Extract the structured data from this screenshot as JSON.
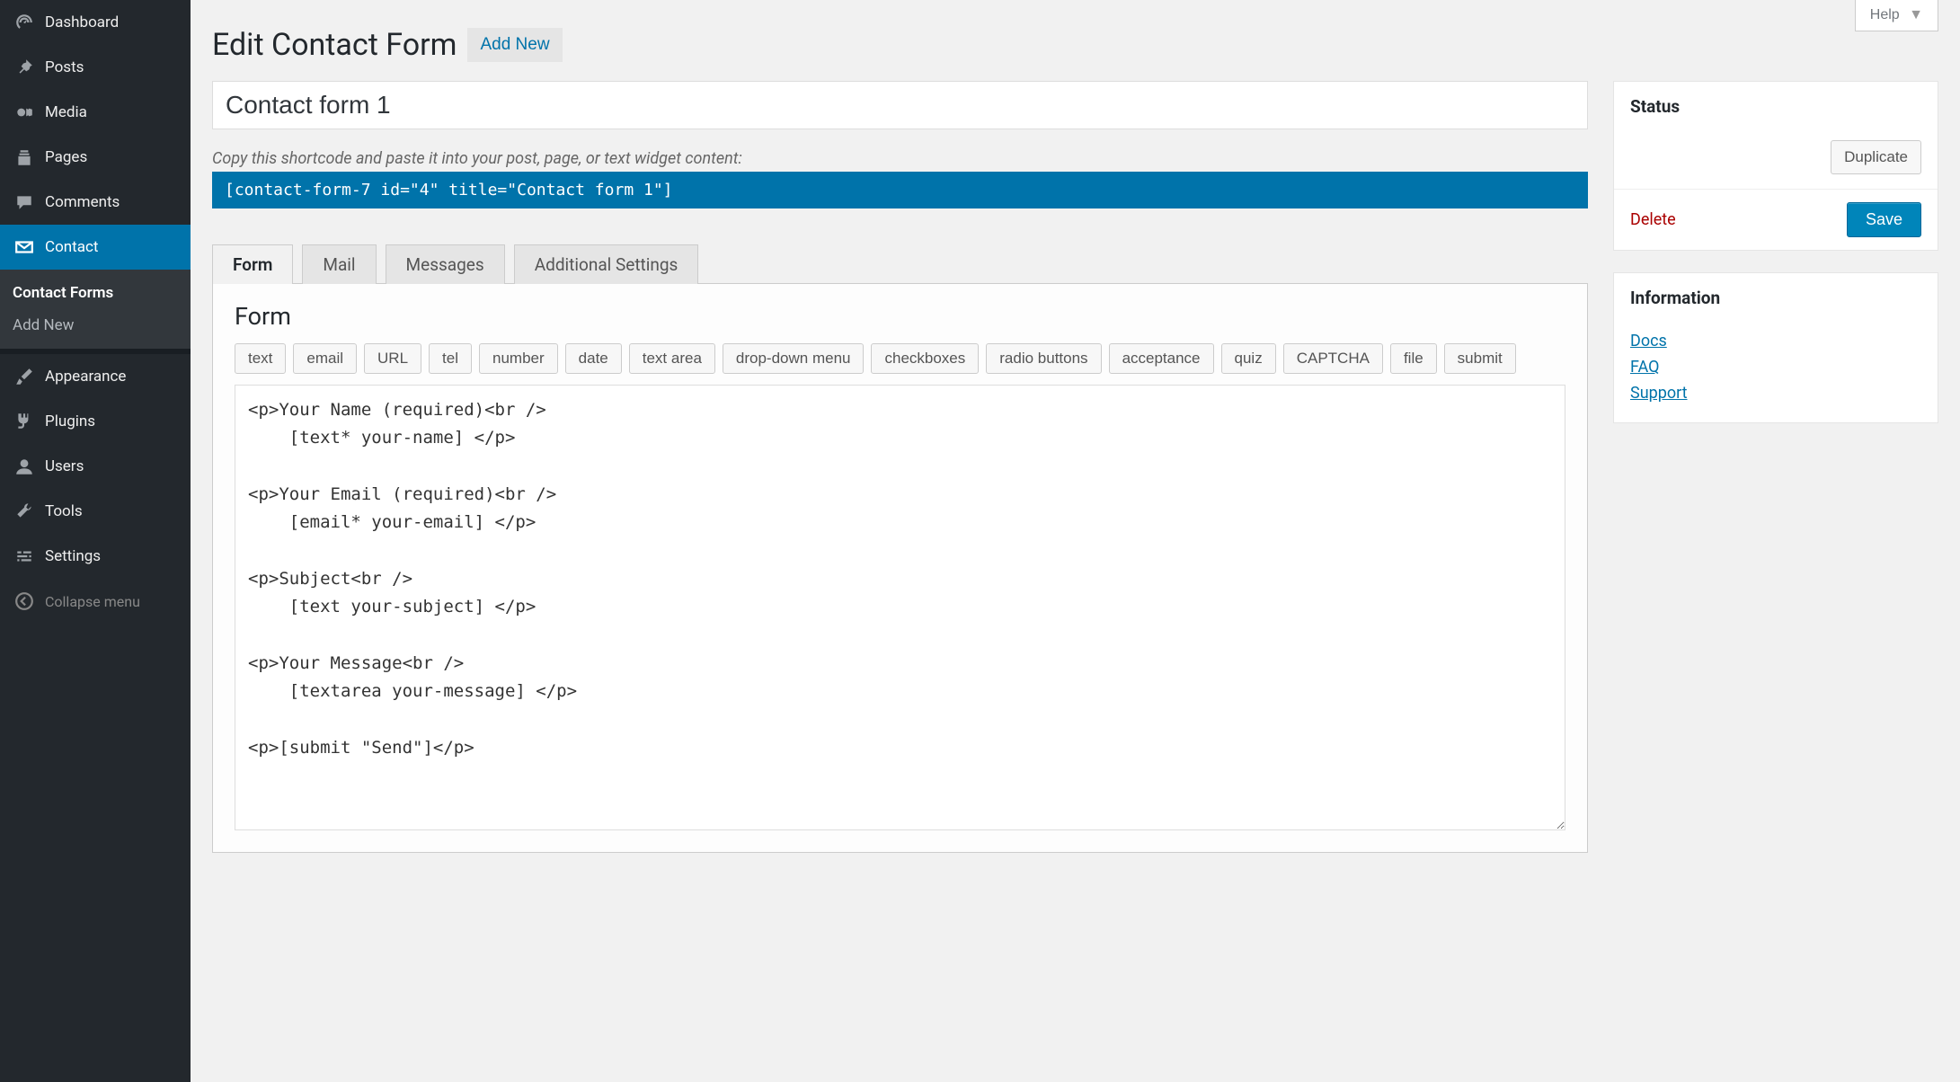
{
  "help_label": "Help",
  "sidebar": {
    "items": [
      {
        "id": "dashboard",
        "label": "Dashboard"
      },
      {
        "id": "posts",
        "label": "Posts"
      },
      {
        "id": "media",
        "label": "Media"
      },
      {
        "id": "pages",
        "label": "Pages"
      },
      {
        "id": "comments",
        "label": "Comments"
      },
      {
        "id": "contact",
        "label": "Contact"
      },
      {
        "id": "appearance",
        "label": "Appearance"
      },
      {
        "id": "plugins",
        "label": "Plugins"
      },
      {
        "id": "users",
        "label": "Users"
      },
      {
        "id": "tools",
        "label": "Tools"
      },
      {
        "id": "settings",
        "label": "Settings"
      }
    ],
    "submenu": [
      {
        "label": "Contact Forms",
        "current": true
      },
      {
        "label": "Add New",
        "current": false
      }
    ],
    "collapse_label": "Collapse menu"
  },
  "header": {
    "title": "Edit Contact Form",
    "add_new": "Add New"
  },
  "form_title": "Contact form 1",
  "shortcode_hint": "Copy this shortcode and paste it into your post, page, or text widget content:",
  "shortcode": "[contact-form-7 id=\"4\" title=\"Contact form 1\"]",
  "tabs": [
    "Form",
    "Mail",
    "Messages",
    "Additional Settings"
  ],
  "active_tab": 0,
  "panel_heading": "Form",
  "tag_buttons": [
    "text",
    "email",
    "URL",
    "tel",
    "number",
    "date",
    "text area",
    "drop-down menu",
    "checkboxes",
    "radio buttons",
    "acceptance",
    "quiz",
    "CAPTCHA",
    "file",
    "submit"
  ],
  "form_body": "<p>Your Name (required)<br />\n    [text* your-name] </p>\n\n<p>Your Email (required)<br />\n    [email* your-email] </p>\n\n<p>Subject<br />\n    [text your-subject] </p>\n\n<p>Your Message<br />\n    [textarea your-message] </p>\n\n<p>[submit \"Send\"]</p>",
  "status": {
    "title": "Status",
    "duplicate": "Duplicate",
    "delete": "Delete",
    "save": "Save"
  },
  "information": {
    "title": "Information",
    "links": [
      "Docs",
      "FAQ",
      "Support"
    ]
  }
}
